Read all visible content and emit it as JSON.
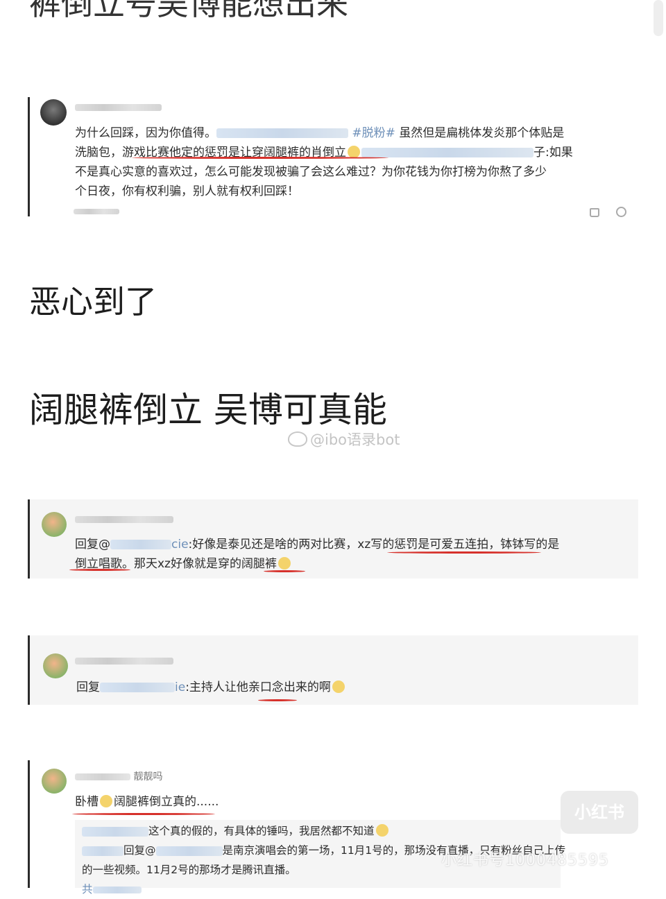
{
  "headings": {
    "top": "裤倒立号吴博能想出来",
    "middle": "恶心到了",
    "bottom": "阔腿裤倒立  吴博可真能"
  },
  "watermark": "@ibo语录bot",
  "comment1": {
    "hashtag": "#脱粉#",
    "text_a": "为什么回踩，因为你值得。",
    "text_b": "虽然但是扁桃体发炎那个体贴是",
    "text_c": "洗脑包，",
    "highlight": "游戏比赛他定的惩罚是让穿阔腿裤的肖倒立",
    "text_d": "子:如果",
    "text_e": "不是真心实意的喜欢过，怎么可能发现被骗了会这么难过？为你花钱为你打榜为你熬了多少",
    "text_f": "个日夜，你有权利骗，别人就有权利回踩！"
  },
  "comment2": {
    "reply_prefix": "回复@",
    "mention_tail": "cie",
    "text_a": ":好像是泰见还是啥的两对比赛，",
    "highlight1": "xz写的惩罚是可爱五连拍",
    "text_b": "，钵钵写的是",
    "highlight2": "倒立唱歌",
    "text_c": "。那天xz好像就是穿的",
    "highlight3": "阔腿裤"
  },
  "comment3": {
    "reply_prefix": "回复",
    "mention_tail": "ie",
    "text_a": ":主持人让他",
    "highlight": "亲口",
    "text_b": "念出来的啊"
  },
  "comment4": {
    "username_tail": "靓靓吗",
    "text_a": "卧槽",
    "text_b": "阔腿裤倒立真的......",
    "sub1": "这个真的假的，有具体的锤吗，我居然都不知道",
    "sub2_prefix": "回复@",
    "sub2": "是南京演唱会的第一场，11月1号的，那场没有直播，只有粉丝自己上传",
    "sub3": "的一些视频。11月2号的那场才是腾讯直播。",
    "sub4": "共"
  },
  "stamp": "小红书",
  "footer_watermark": "小红书号1000485595"
}
